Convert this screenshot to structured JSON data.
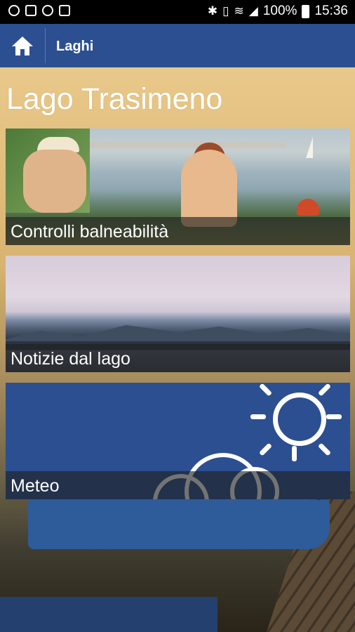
{
  "status_bar": {
    "battery": "100%",
    "time": "15:36",
    "icons": [
      "settings-icon",
      "image-icon",
      "cloud-icon",
      "photo-icon",
      "bluetooth-icon",
      "vibrate-icon",
      "wifi-icon",
      "signal-icon",
      "battery-icon"
    ]
  },
  "app_bar": {
    "title": "Laghi",
    "home_icon": "home-icon",
    "color": "#2c4f91"
  },
  "page": {
    "title": "Lago Trasimeno"
  },
  "tiles": [
    {
      "label": "Controlli balneabilità",
      "image": "painting-bathers"
    },
    {
      "label": "Notizie dal lago",
      "image": "lake-landscape"
    },
    {
      "label": "Meteo",
      "image": "weather-sun-cloud-icon"
    }
  ]
}
